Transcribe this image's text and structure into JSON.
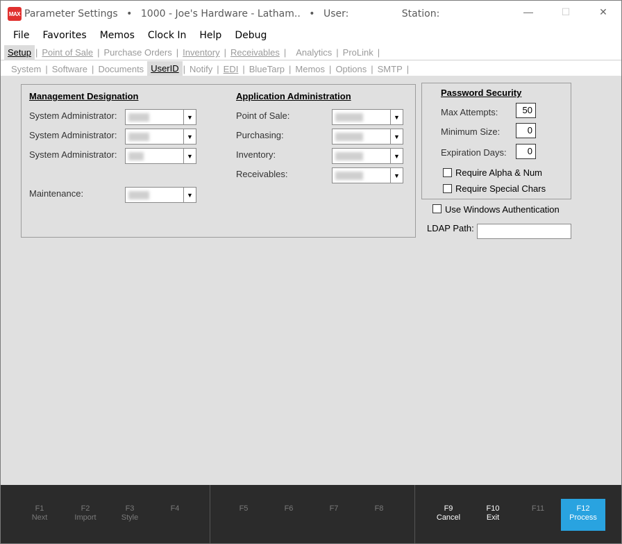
{
  "titlebar": {
    "app_icon_text": "MAX",
    "app_name": "Parameter Settings",
    "bullet": "•",
    "store": "1000 - Joe's Hardware - Latham..",
    "user_label": "User:",
    "station_label": "Station:"
  },
  "window_controls": {
    "minimize": "—",
    "maximize": "☐",
    "close": "✕"
  },
  "menu": [
    "File",
    "Favorites",
    "Memos",
    "Clock In",
    "Help",
    "Debug"
  ],
  "tabs_row1": [
    "Setup",
    "Point of Sale",
    "Purchase Orders",
    "Inventory",
    "Receivables",
    "Analytics",
    "ProLink"
  ],
  "tabs_row2": [
    "System",
    "Software",
    "Documents",
    "UserID",
    "Notify",
    "EDI",
    "BlueTarp",
    "Memos",
    "Options",
    "SMTP"
  ],
  "management": {
    "title": "Management Designation",
    "rows": [
      "System Administrator:",
      "System Administrator:",
      "System Administrator:"
    ],
    "maintenance": "Maintenance:"
  },
  "application": {
    "title": "Application Administration",
    "rows": [
      "Point of Sale:",
      "Purchasing:",
      "Inventory:",
      "Receivables:"
    ]
  },
  "password": {
    "title": "Password Security",
    "max_attempts_label": "Max Attempts:",
    "max_attempts": "50",
    "min_size_label": "Minimum Size:",
    "min_size": "0",
    "expiration_label": "Expiration Days:",
    "expiration": "0",
    "require_alpha": "Require Alpha & Num",
    "require_special": "Require Special Chars"
  },
  "windows_auth": "Use Windows Authentication",
  "ldap_label": "LDAP Path:",
  "fkeys": [
    {
      "key": "F1",
      "label": "Next"
    },
    {
      "key": "F2",
      "label": "Import"
    },
    {
      "key": "F3",
      "label": "Style"
    },
    {
      "key": "F4",
      "label": ""
    },
    {
      "key": "F5",
      "label": ""
    },
    {
      "key": "F6",
      "label": ""
    },
    {
      "key": "F7",
      "label": ""
    },
    {
      "key": "F8",
      "label": ""
    },
    {
      "key": "F9",
      "label": "Cancel"
    },
    {
      "key": "F10",
      "label": "Exit"
    },
    {
      "key": "F11",
      "label": ""
    },
    {
      "key": "F12",
      "label": "Process"
    }
  ]
}
